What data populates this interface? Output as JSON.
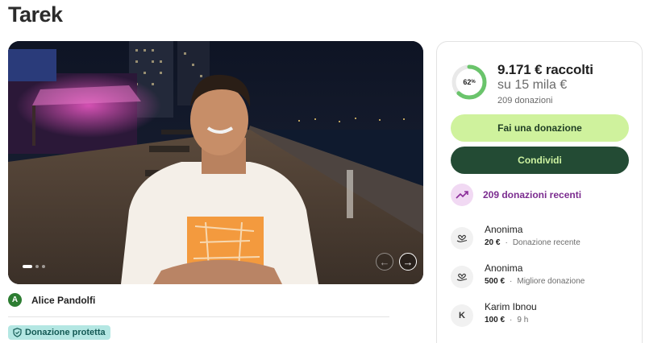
{
  "page": {
    "title": "Tarek"
  },
  "hero": {
    "slides_total": 3,
    "active_slide": 1,
    "prev_icon": "arrow-left-icon",
    "next_icon": "arrow-right-icon"
  },
  "organizer": {
    "initial": "A",
    "name": "Alice Pandolfi",
    "avatar_color": "#2d7d32"
  },
  "badge": {
    "label": "Donazione protetta",
    "icon": "shield-icon"
  },
  "fundraiser": {
    "progress_percent": 62,
    "progress_label": "62",
    "progress_suffix": "%",
    "raised": "9.171 € raccolti",
    "goal": "su 15 mila €",
    "donations": "209 donazioni"
  },
  "actions": {
    "donate_label": "Fai una donazione",
    "share_label": "Condividi"
  },
  "recent": {
    "label": "209 donazioni recenti",
    "icon": "trending-up-icon"
  },
  "donors": [
    {
      "avatar_icon": "heart-hand-icon",
      "initial": "",
      "name": "Anonima",
      "amount": "20 €",
      "sep": "·",
      "note": "Donazione recente"
    },
    {
      "avatar_icon": "heart-hand-icon",
      "initial": "",
      "name": "Anonima",
      "amount": "500 €",
      "sep": "·",
      "note": "Migliore donazione"
    },
    {
      "avatar_icon": "initial",
      "initial": "K",
      "name": "Karim Ibnou",
      "amount": "100 €",
      "sep": "·",
      "note": "9 h"
    }
  ],
  "colors": {
    "accent_light": "#cff29d",
    "accent_dark": "#234b34",
    "ring": "#6ac46b",
    "recent_purple": "#7b2c8f",
    "badge_bg": "#b4e7e3"
  }
}
